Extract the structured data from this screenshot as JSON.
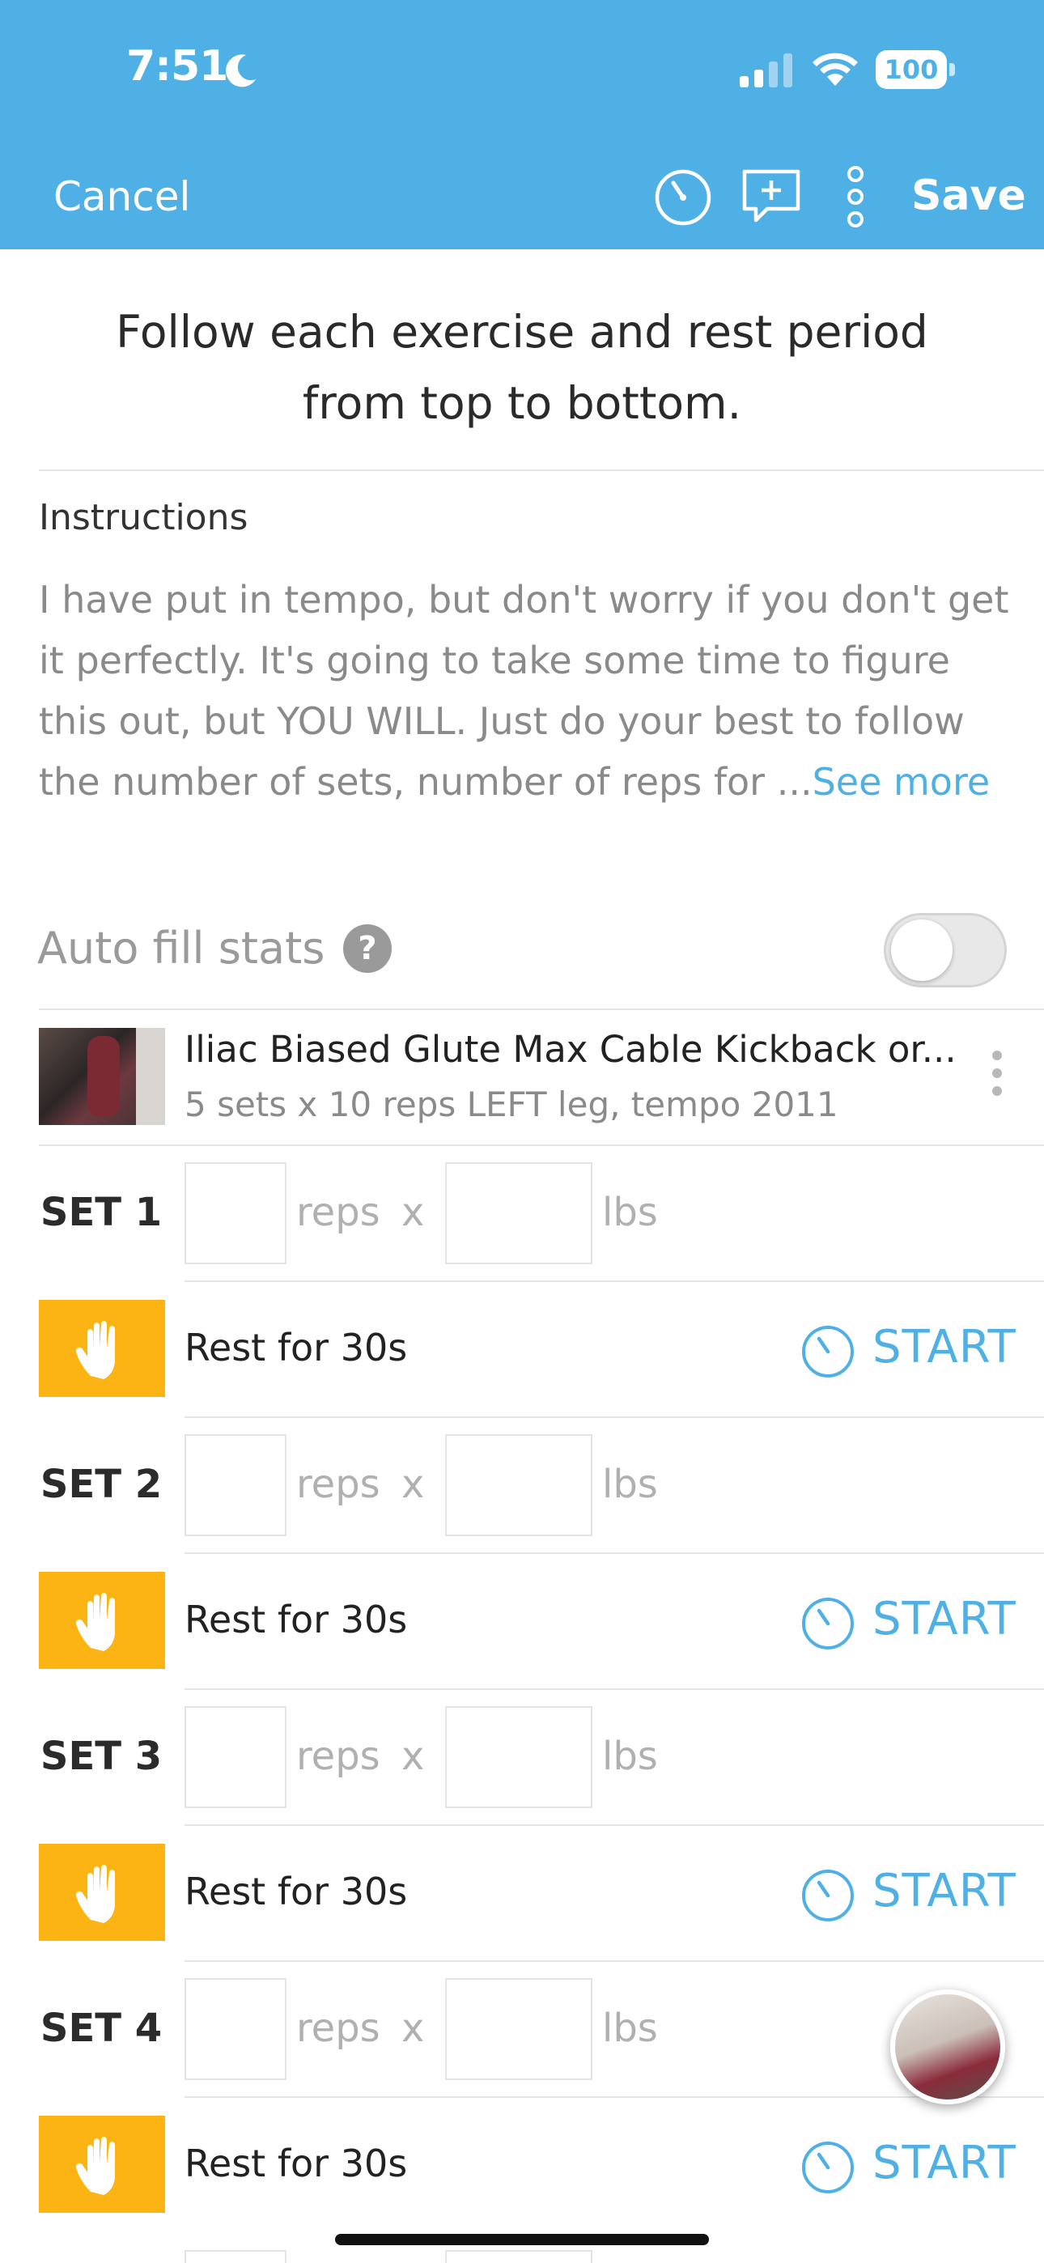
{
  "status_bar": {
    "time": "7:51",
    "battery": "100"
  },
  "header": {
    "cancel_label": "Cancel",
    "save_label": "Save",
    "icons": [
      "timer-icon",
      "add-comment-icon",
      "more-vertical-icon"
    ]
  },
  "intro": "Follow each exercise and rest period from top to bottom.",
  "instructions": {
    "title": "Instructions",
    "text": "I have put in tempo, but don't worry if you don't get it perfectly.  It's going to take some time to figure this out, but YOU WILL.  Just do your best to follow the number of sets, number of reps for ...",
    "see_more": "See more"
  },
  "auto_fill": {
    "label": "Auto fill stats",
    "help": "?",
    "enabled": false
  },
  "exercise": {
    "title": "Iliac Biased Glute Max Cable Kickback or...",
    "subtitle": "5 sets x 10 reps LEFT leg, tempo 2011"
  },
  "sets": [
    {
      "label": "SET 1",
      "reps_unit": "reps",
      "times": "x",
      "weight_unit": "lbs"
    },
    {
      "label": "SET 2",
      "reps_unit": "reps",
      "times": "x",
      "weight_unit": "lbs"
    },
    {
      "label": "SET 3",
      "reps_unit": "reps",
      "times": "x",
      "weight_unit": "lbs"
    },
    {
      "label": "SET 4",
      "reps_unit": "reps",
      "times": "x",
      "weight_unit": "lbs"
    }
  ],
  "rests": [
    {
      "text": "Rest for 30s",
      "start": "START"
    },
    {
      "text": "Rest for 30s",
      "start": "START"
    },
    {
      "text": "Rest for 30s",
      "start": "START"
    },
    {
      "text": "Rest for 30s",
      "start": "START"
    }
  ],
  "colors": {
    "header": "#4fb0e6",
    "rest": "#fbb414",
    "accent": "#4fb0e6"
  }
}
